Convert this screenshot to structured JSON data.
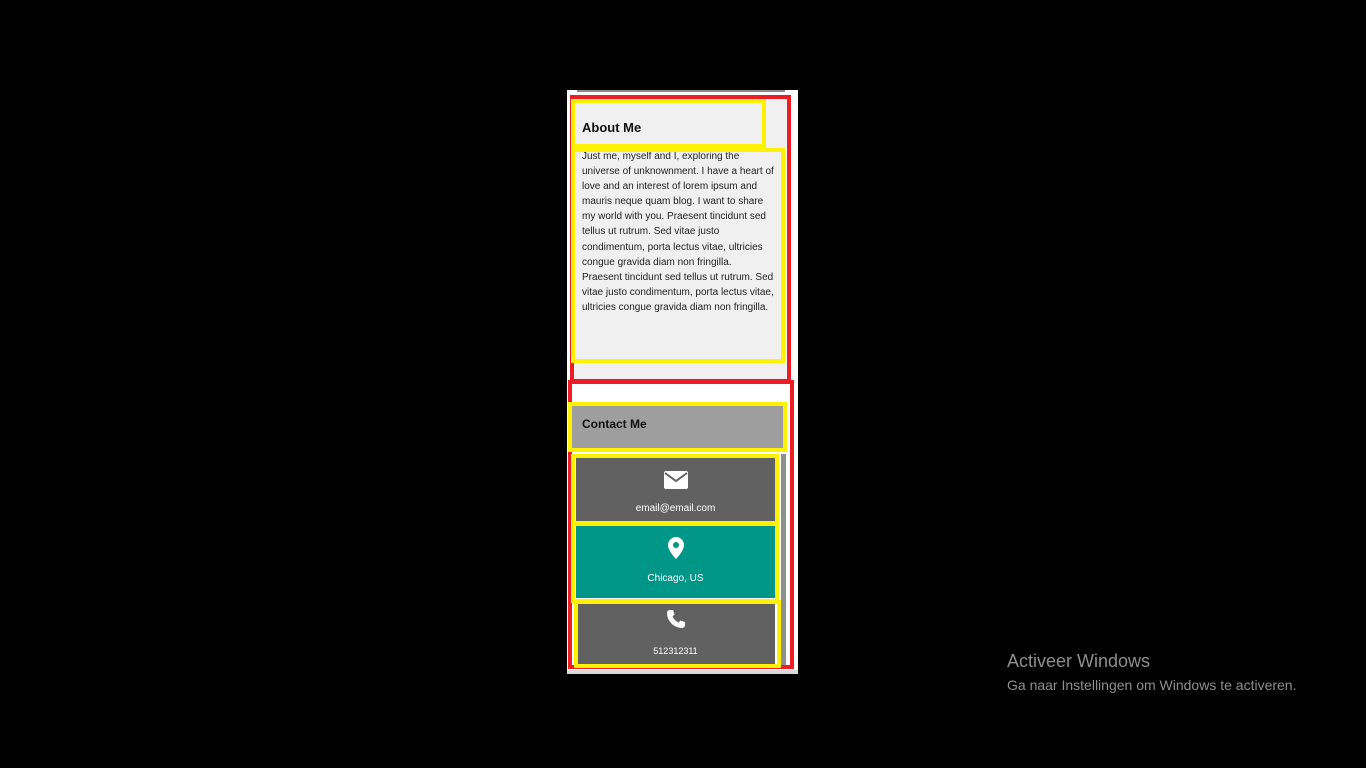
{
  "about": {
    "title": "About Me",
    "text": "Just me, myself and I, exploring the universe of unknownment. I have a heart of love and an interest of lorem ipsum and mauris neque quam blog. I want to share my world with you. Praesent tincidunt sed tellus ut rutrum. Sed vitae justo condimentum, porta lectus vitae, ultricies congue gravida diam non fringilla. Praesent tincidunt sed tellus ut rutrum. Sed vitae justo condimentum, porta lectus vitae, ultricies congue gravida diam non fringilla."
  },
  "contact": {
    "title": "Contact Me",
    "items": [
      {
        "icon": "envelope-icon",
        "label": "email@email.com",
        "color": "#616161"
      },
      {
        "icon": "map-marker-icon",
        "label": "Chicago, US",
        "color": "#009688"
      },
      {
        "icon": "phone-icon",
        "label": "512312311",
        "color": "#616161"
      }
    ]
  },
  "annotation_colors": {
    "red": "#ee1c25",
    "yellow": "#fff200"
  },
  "watermark": {
    "title": "Activeer Windows",
    "subtitle": "Ga naar Instellingen om Windows te activeren."
  }
}
